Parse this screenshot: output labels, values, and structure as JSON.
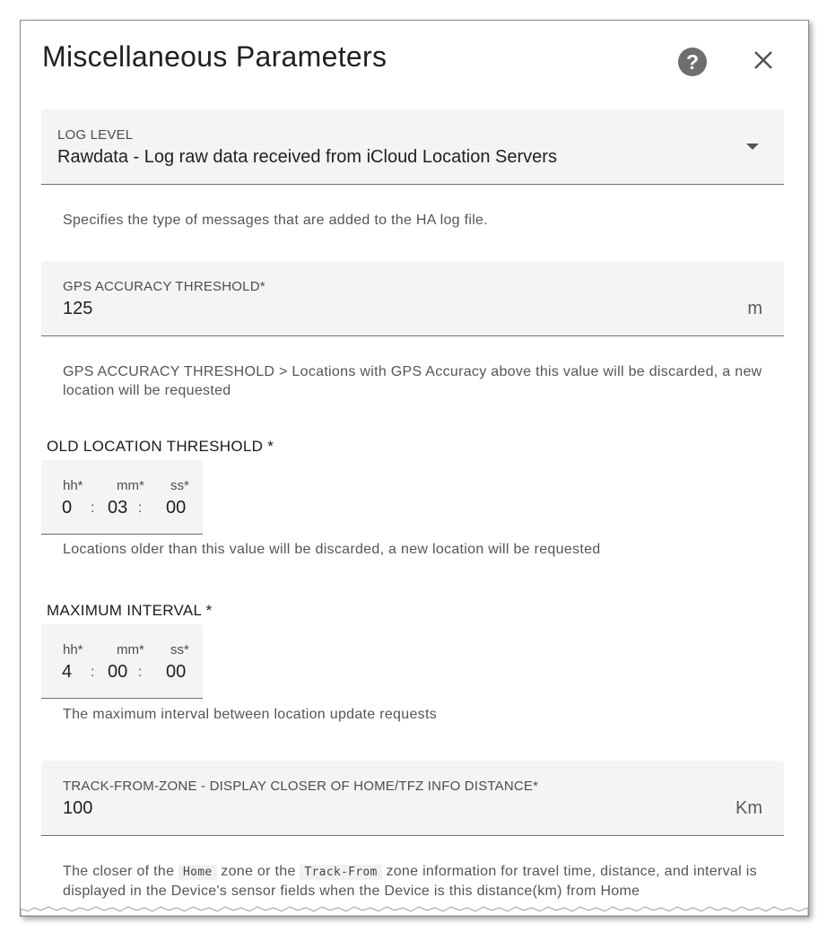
{
  "dialog": {
    "title": "Miscellaneous Parameters",
    "help_icon": "help-circle-icon",
    "close_icon": "close-icon"
  },
  "log_level": {
    "label": "LOG LEVEL",
    "value": "Rawdata - Log raw data received from iCloud Location Servers",
    "helper": "Specifies the type of messages that are added to the HA log file."
  },
  "gps_accuracy": {
    "label": "GPS ACCURACY THRESHOLD*",
    "value": "125",
    "suffix": "m",
    "helper": "GPS ACCURACY THRESHOLD > Locations with GPS Accuracy above this value will be discarded, a new location will be requested"
  },
  "old_location": {
    "label": "OLD LOCATION THRESHOLD *",
    "hh_label": "hh*",
    "mm_label": "mm*",
    "ss_label": "ss*",
    "hh": "0",
    "mm": "03",
    "ss": "00",
    "helper": "Locations older than this value will be discarded, a new location will be requested"
  },
  "max_interval": {
    "label": "MAXIMUM INTERVAL *",
    "hh_label": "hh*",
    "mm_label": "mm*",
    "ss_label": "ss*",
    "hh": "4",
    "mm": "00",
    "ss": "00",
    "helper": "The maximum interval between location update requests"
  },
  "tfz_distance": {
    "label": "TRACK-FROM-ZONE - DISPLAY CLOSER OF HOME/TFZ INFO DISTANCE*",
    "value": "100",
    "suffix": "Km",
    "helper_part1": "The closer of the",
    "helper_code1": "Home",
    "helper_part2": "zone or the",
    "helper_code2": "Track-From",
    "helper_part3": "zone information for travel time, distance, and interval is displayed in the Device's sensor fields when the Device is this distance(km) from Home"
  },
  "separator": ":"
}
